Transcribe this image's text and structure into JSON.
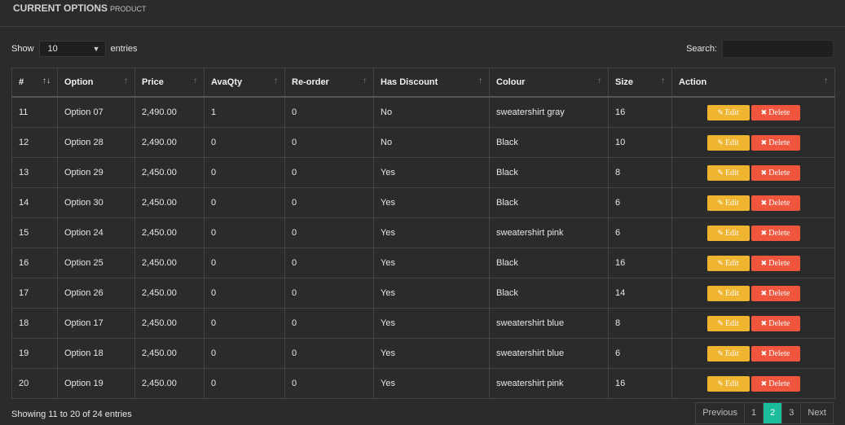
{
  "header": {
    "title": "CURRENT OPTIONS",
    "subtitle": "PRODUCT"
  },
  "length_menu": {
    "show_label": "Show",
    "selected": "10",
    "entries_label": "entries"
  },
  "search": {
    "label": "Search:"
  },
  "columns": [
    "#",
    "Option",
    "Price",
    "AvaQty",
    "Re-order",
    "Has Discount",
    "Colour",
    "Size",
    "Action"
  ],
  "rows": [
    {
      "id": "11",
      "option": "Option 07",
      "price": "2,490.00",
      "qty": "1",
      "reorder": "0",
      "discount": "No",
      "colour": "sweatershirt gray",
      "size": "16"
    },
    {
      "id": "12",
      "option": "Option 28",
      "price": "2,490.00",
      "qty": "0",
      "reorder": "0",
      "discount": "No",
      "colour": "Black",
      "size": "10"
    },
    {
      "id": "13",
      "option": "Option 29",
      "price": "2,450.00",
      "qty": "0",
      "reorder": "0",
      "discount": "Yes",
      "colour": "Black",
      "size": "8"
    },
    {
      "id": "14",
      "option": "Option 30",
      "price": "2,450.00",
      "qty": "0",
      "reorder": "0",
      "discount": "Yes",
      "colour": "Black",
      "size": "6"
    },
    {
      "id": "15",
      "option": "Option 24",
      "price": "2,450.00",
      "qty": "0",
      "reorder": "0",
      "discount": "Yes",
      "colour": "sweatershirt pink",
      "size": "6"
    },
    {
      "id": "16",
      "option": "Option 25",
      "price": "2,450.00",
      "qty": "0",
      "reorder": "0",
      "discount": "Yes",
      "colour": "Black",
      "size": "16"
    },
    {
      "id": "17",
      "option": "Option 26",
      "price": "2,450.00",
      "qty": "0",
      "reorder": "0",
      "discount": "Yes",
      "colour": "Black",
      "size": "14"
    },
    {
      "id": "18",
      "option": "Option 17",
      "price": "2,450.00",
      "qty": "0",
      "reorder": "0",
      "discount": "Yes",
      "colour": "sweatershirt blue",
      "size": "8"
    },
    {
      "id": "19",
      "option": "Option 18",
      "price": "2,450.00",
      "qty": "0",
      "reorder": "0",
      "discount": "Yes",
      "colour": "sweatershirt blue",
      "size": "6"
    },
    {
      "id": "20",
      "option": "Option 19",
      "price": "2,450.00",
      "qty": "0",
      "reorder": "0",
      "discount": "Yes",
      "colour": "sweatershirt pink",
      "size": "16"
    }
  ],
  "actions": {
    "edit_label": "Edit",
    "delete_label": "Delete",
    "edit_icon": "edit-icon",
    "delete_icon": "close-icon"
  },
  "info": "Showing 11 to 20 of 24 entries",
  "pagination": {
    "previous": "Previous",
    "pages": [
      "1",
      "2",
      "3"
    ],
    "active": "2",
    "next": "Next"
  },
  "colors": {
    "background": "#2b2b2b",
    "edit": "#efb531",
    "delete": "#f0553d",
    "active_page": "#1abc9c"
  }
}
